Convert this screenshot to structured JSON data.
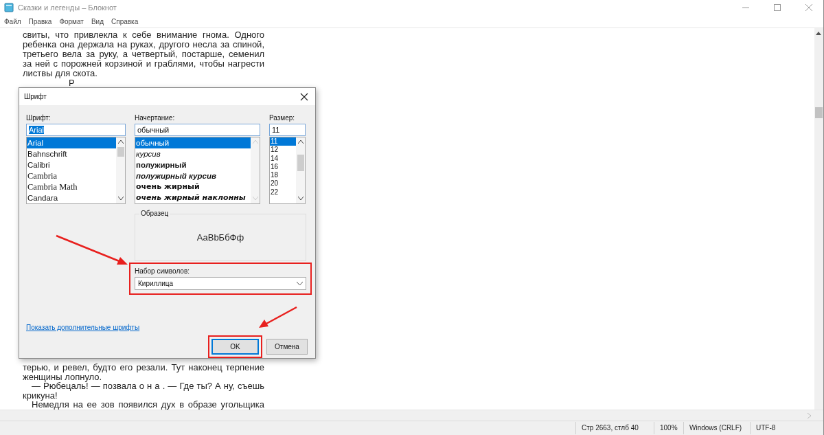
{
  "window": {
    "title": "Сказки и легенды – Блокнот"
  },
  "menu": [
    "Файл",
    "Правка",
    "Формат",
    "Вид",
    "Справка"
  ],
  "text_top": [
    {
      "text": "свиты, что привлекла к себе внимание гнома. Одного",
      "justified": true,
      "indented": false
    },
    {
      "text": "ребенка она держала на руках, другого несла за спиной,",
      "justified": true,
      "indented": false
    },
    {
      "text": "третьего вела за руку, а четвертый, постарше, семенил",
      "justified": true,
      "indented": false
    },
    {
      "text": "за ней с порожней корзиной и граблями, чтобы нагрести",
      "justified": true,
      "indented": false
    },
    {
      "text": "листвы для скота.",
      "justified": false,
      "indented": false
    }
  ],
  "heading": "Р",
  "text_bottom": [
    {
      "text": "терью, и ревел, будто его резали. Тут наконец терпение",
      "justified": true,
      "indented": false
    },
    {
      "text": "женщины   лопнуло.",
      "justified": false,
      "indented": false
    },
    {
      "text": "— Рюбецаль! — позвала  о н а . — Где ты? А ну, съешь",
      "justified": true,
      "indented": true
    },
    {
      "text": "крикуна!",
      "justified": false,
      "indented": false
    },
    {
      "text": "Немедля на ее зов появился дух в образе угольщика",
      "justified": true,
      "indented": true
    }
  ],
  "dialog": {
    "title": "Шрифт",
    "font": {
      "label": "Шрифт:",
      "value": "Arial",
      "value_selected": true,
      "items": [
        {
          "label": "Arial",
          "kind": "sans",
          "selected": true
        },
        {
          "label": "Bahnschrift",
          "kind": "sans",
          "selected": false
        },
        {
          "label": "Calibri",
          "kind": "sans",
          "selected": false
        },
        {
          "label": "Cambria",
          "kind": "serif",
          "selected": false
        },
        {
          "label": "Cambria Math",
          "kind": "serif",
          "selected": false
        },
        {
          "label": "Candara",
          "kind": "sans",
          "selected": false
        }
      ]
    },
    "style": {
      "label": "Начертание:",
      "value": "обычный",
      "items": [
        {
          "label": "обычный",
          "kind": "regular",
          "selected": true
        },
        {
          "label": "курсив",
          "kind": "italic",
          "selected": false
        },
        {
          "label": "полужирный",
          "kind": "bold",
          "selected": false
        },
        {
          "label": "полужирный курсив",
          "kind": "bold-italic",
          "selected": false
        },
        {
          "label": "очень жирный",
          "kind": "black",
          "selected": false
        },
        {
          "label": "очень жирный наклонны",
          "kind": "black-italic",
          "selected": false
        }
      ]
    },
    "size": {
      "label": "Размер:",
      "value": "11",
      "items": [
        {
          "label": "11",
          "selected": true
        },
        {
          "label": "12",
          "selected": false
        },
        {
          "label": "14",
          "selected": false
        },
        {
          "label": "16",
          "selected": false
        },
        {
          "label": "18",
          "selected": false
        },
        {
          "label": "20",
          "selected": false
        },
        {
          "label": "22",
          "selected": false
        }
      ]
    },
    "sample": {
      "label": "Образец",
      "text": "AaBbБбФф"
    },
    "charset": {
      "label": "Набор символов:",
      "value": "Кириллица"
    },
    "link": "Показать дополнительные шрифты",
    "buttons": [
      {
        "label": "OK",
        "kind": "default"
      },
      {
        "label": "Отмена",
        "kind": "normal"
      }
    ]
  },
  "status_bar": [
    "Стр 2663, стлб 40",
    "100%",
    "Windows (CRLF)",
    "UTF-8"
  ]
}
